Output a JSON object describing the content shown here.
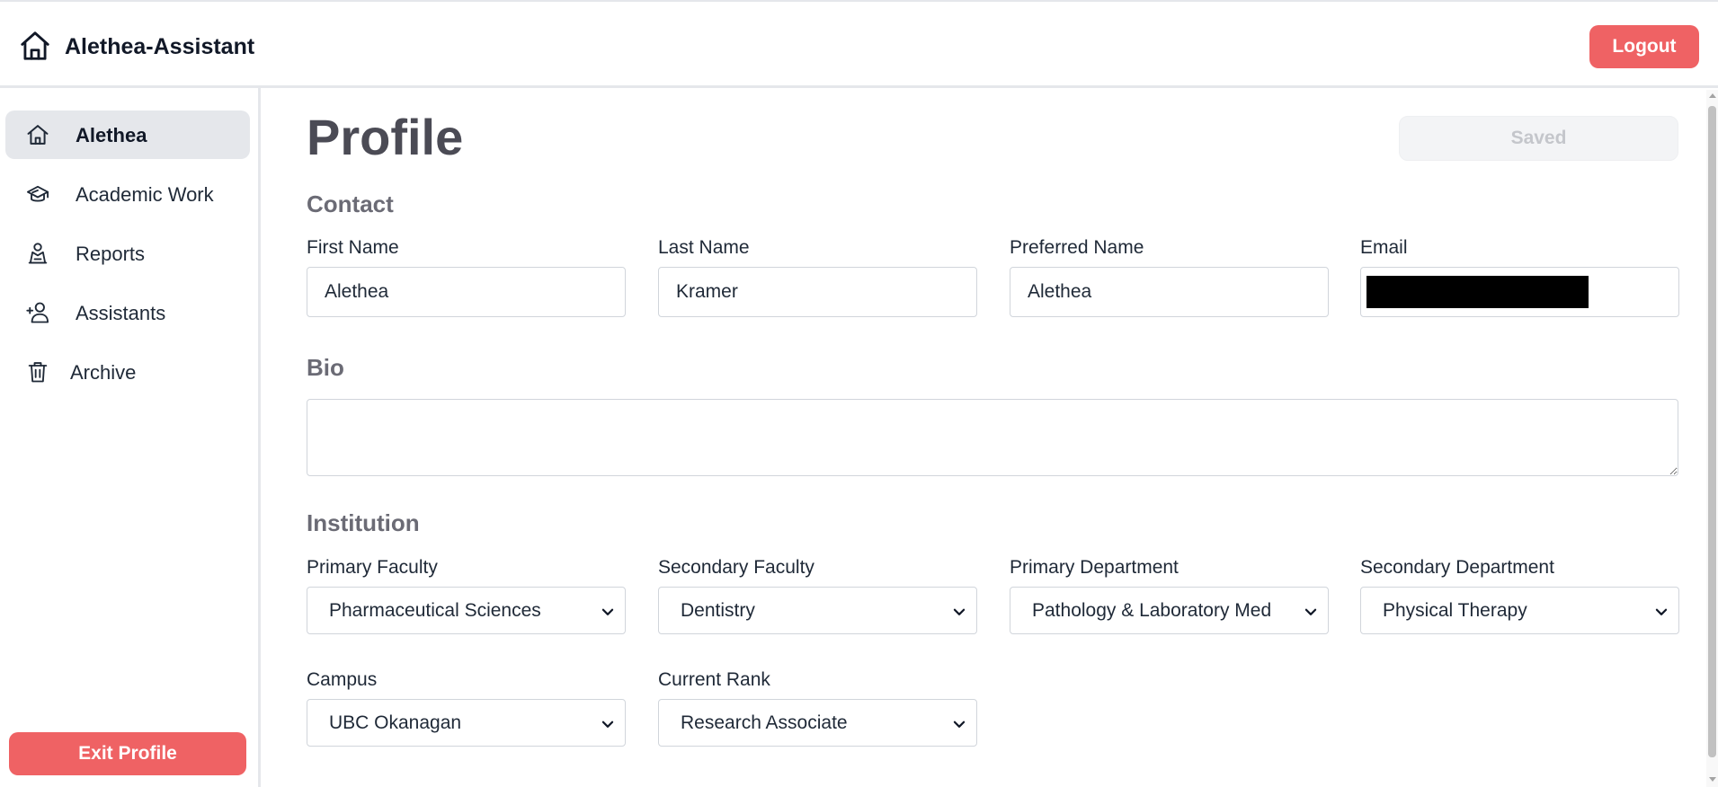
{
  "app": {
    "title": "Alethea-Assistant",
    "logout_label": "Logout",
    "accent_color": "#ef6264"
  },
  "sidebar": {
    "items": [
      {
        "label": "Alethea",
        "icon": "home-icon",
        "active": true
      },
      {
        "label": "Academic Work",
        "icon": "graduation-cap-icon",
        "active": false
      },
      {
        "label": "Reports",
        "icon": "report-person-icon",
        "active": false
      },
      {
        "label": "Assistants",
        "icon": "add-user-icon",
        "active": false
      },
      {
        "label": "Archive",
        "icon": "trash-icon",
        "active": false
      }
    ],
    "exit_label": "Exit Profile"
  },
  "main": {
    "title": "Profile",
    "save_status": "Saved",
    "contact": {
      "heading": "Contact",
      "first_name_label": "First Name",
      "first_name": "Alethea",
      "last_name_label": "Last Name",
      "last_name": "Kramer",
      "preferred_name_label": "Preferred Name",
      "preferred_name": "Alethea",
      "email_label": "Email"
    },
    "bio": {
      "heading": "Bio",
      "value": ""
    },
    "institution": {
      "heading": "Institution",
      "primary_faculty_label": "Primary Faculty",
      "primary_faculty": "Pharmaceutical Sciences",
      "secondary_faculty_label": "Secondary Faculty",
      "secondary_faculty": "Dentistry",
      "primary_department_label": "Primary Department",
      "primary_department": "Pathology & Laboratory Med",
      "secondary_department_label": "Secondary Department",
      "secondary_department": "Physical Therapy",
      "campus_label": "Campus",
      "campus": "UBC Okanagan",
      "current_rank_label": "Current Rank",
      "current_rank": "Research Associate"
    }
  }
}
